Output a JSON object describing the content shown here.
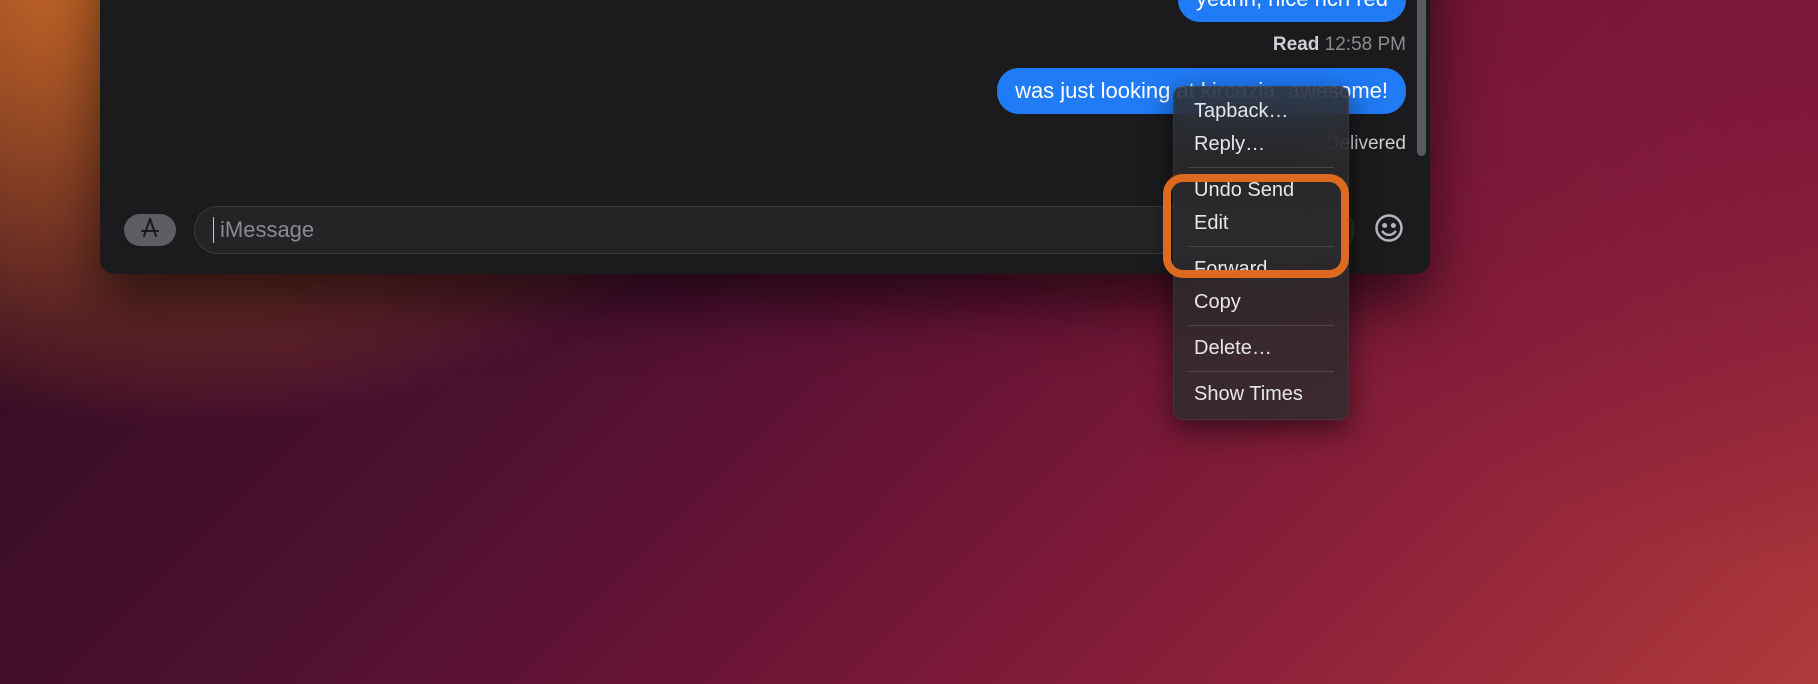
{
  "messages": {
    "bubble1": "yeahh, nice rich red",
    "read_label": "Read",
    "read_time": "12:58 PM",
    "bubble2": "was just looking at kircazia, awesome!",
    "delivered_label": "Delivered"
  },
  "compose": {
    "placeholder": "iMessage"
  },
  "context_menu": {
    "tapback": "Tapback…",
    "reply": "Reply…",
    "undo_send": "Undo Send",
    "edit": "Edit",
    "forward": "Forward…",
    "copy": "Copy",
    "delete": "Delete…",
    "show_times": "Show Times"
  }
}
